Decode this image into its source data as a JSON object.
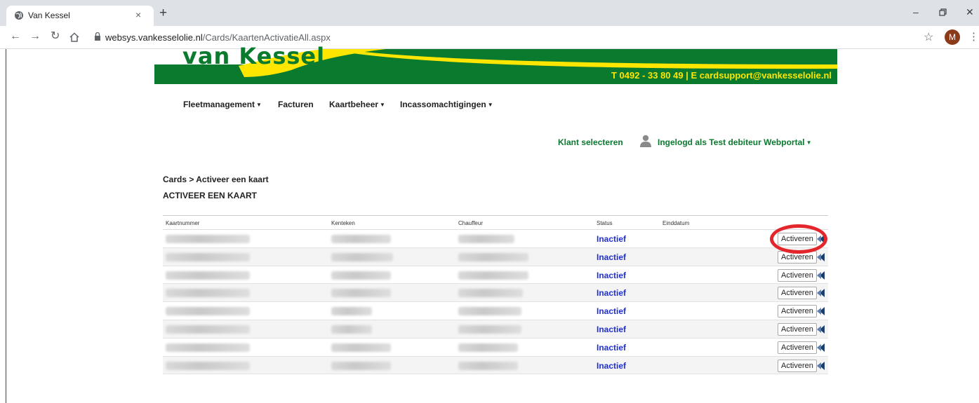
{
  "browser": {
    "tab_title": "Van Kessel",
    "tab_close": "×",
    "new_tab": "+",
    "url_host": "websys.vankesselolie.nl",
    "url_path": "/Cards/KaartenActivatieAll.aspx",
    "profile_initial": "M",
    "icons": [
      "globe-icon",
      "back-icon",
      "forward-icon",
      "reload-icon",
      "home-icon",
      "lock-icon",
      "star-icon",
      "menu-icon",
      "minimize-icon",
      "restore-icon",
      "close-icon"
    ]
  },
  "banner": {
    "logo": "van Kessel",
    "contact": "T  0492 - 33 80 49   |   E  cardsupport@vankesselolie.nl",
    "green": "#0a7a2e",
    "yellow": "#ffe600"
  },
  "menu": {
    "fleet": "Fleetmanagement",
    "invoices": "Facturen",
    "cards": "Kaartbeheer",
    "direct_debit": "Incassomachtigingen",
    "select_client": "Klant selecteren",
    "logged_in": "Ingelogd als Test debiteur Webportal"
  },
  "page": {
    "breadcrumb": "Cards > Activeer een kaart",
    "title": "ACTIVEER EEN KAART"
  },
  "table": {
    "columns": [
      "Kaartnummer",
      "Kenteken",
      "Chauffeur",
      "Status",
      "Einddatum"
    ],
    "rows": [
      {
        "status": "Inactief",
        "action": "Activeren"
      },
      {
        "status": "Inactief",
        "action": "Activeren"
      },
      {
        "status": "Inactief",
        "action": "Activeren"
      },
      {
        "status": "Inactief",
        "action": "Activeren"
      },
      {
        "status": "Inactief",
        "action": "Activeren"
      },
      {
        "status": "Inactief",
        "action": "Activeren"
      },
      {
        "status": "Inactief",
        "action": "Activeren"
      },
      {
        "status": "Inactief",
        "action": "Activeren"
      }
    ],
    "status_color": "#1f2fd1",
    "highlight_color": "#e3262b"
  }
}
